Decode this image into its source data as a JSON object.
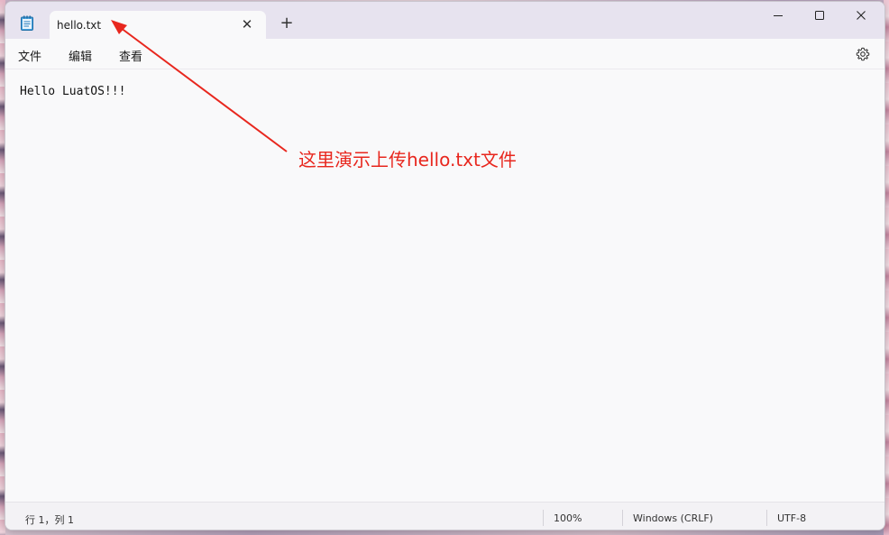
{
  "window": {
    "tab_title": "hello.txt",
    "new_tab_symbol": "+",
    "close_tab_symbol": "✕"
  },
  "menu": {
    "file": "文件",
    "edit": "编辑",
    "view": "查看"
  },
  "editor": {
    "content": "Hello LuatOS!!!"
  },
  "status": {
    "position": "行 1，列 1",
    "zoom": "100%",
    "line_ending": "Windows (CRLF)",
    "encoding": "UTF-8"
  },
  "annotation": {
    "text": "这里演示上传hello.txt文件",
    "color": "#e8271e"
  },
  "icons": {
    "app": "notepad-icon",
    "minimize": "minimize-icon",
    "maximize": "maximize-icon",
    "close": "close-icon",
    "settings": "gear-icon"
  },
  "colors": {
    "titlebar": "#e7e3ef",
    "editor_bg": "#f9f9fa",
    "statusbar": "#f3f2f5"
  }
}
